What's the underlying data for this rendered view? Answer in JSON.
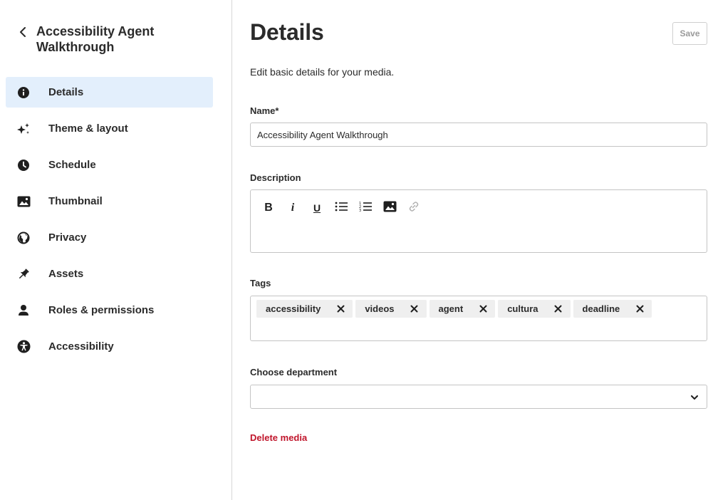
{
  "sidebar": {
    "media_title": "Accessibility Agent Walkthrough",
    "items": [
      {
        "label": "Details",
        "icon": "info-icon",
        "active": true
      },
      {
        "label": "Theme & layout",
        "icon": "sparkles-icon",
        "active": false
      },
      {
        "label": "Schedule",
        "icon": "clock-icon",
        "active": false
      },
      {
        "label": "Thumbnail",
        "icon": "image-icon",
        "active": false
      },
      {
        "label": "Privacy",
        "icon": "globe-icon",
        "active": false
      },
      {
        "label": "Assets",
        "icon": "pin-icon",
        "active": false
      },
      {
        "label": "Roles & permissions",
        "icon": "user-icon",
        "active": false
      },
      {
        "label": "Accessibility",
        "icon": "accessibility-icon",
        "active": false
      }
    ]
  },
  "main": {
    "title": "Details",
    "save_label": "Save",
    "subtitle": "Edit basic details for your media.",
    "name_label": "Name",
    "name_required_mark": "*",
    "name_value": "Accessibility Agent Walkthrough",
    "description_label": "Description",
    "toolbar": [
      {
        "name": "bold-button",
        "glyph": "B"
      },
      {
        "name": "italic-button",
        "glyph": "i"
      },
      {
        "name": "underline-button",
        "glyph": "U"
      },
      {
        "name": "bullet-list-button",
        "glyph": ""
      },
      {
        "name": "numbered-list-button",
        "glyph": ""
      },
      {
        "name": "insert-image-button",
        "glyph": ""
      },
      {
        "name": "insert-link-button",
        "glyph": ""
      }
    ],
    "tags_label": "Tags",
    "tags": [
      "accessibility",
      "videos",
      "agent",
      "cultura",
      "deadline"
    ],
    "department_label": "Choose department",
    "department_value": "",
    "delete_label": "Delete media"
  },
  "colors": {
    "active_nav_bg": "#e3effc",
    "delete_red": "#c0152b",
    "text": "#2b2b2b"
  }
}
